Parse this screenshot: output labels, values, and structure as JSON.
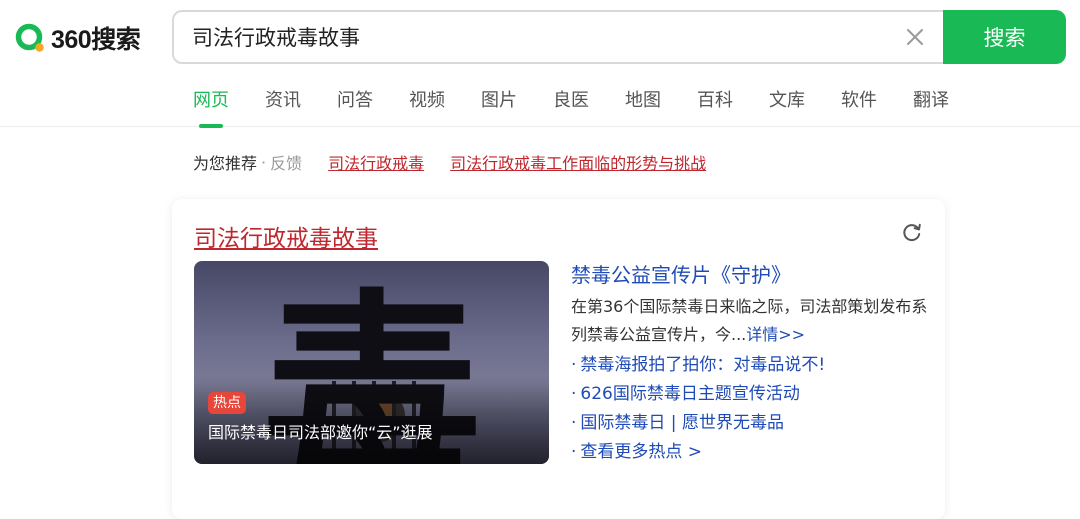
{
  "brand": {
    "logo_text": "360搜索",
    "accent": "#19b955",
    "link_red": "#c0262d",
    "link_blue": "#1f4bb6"
  },
  "search": {
    "query": "司法行政戒毒故事",
    "button_label": "搜索",
    "clear_icon": "close-icon"
  },
  "tabs": [
    {
      "label": "网页",
      "active": true
    },
    {
      "label": "资讯"
    },
    {
      "label": "问答"
    },
    {
      "label": "视频"
    },
    {
      "label": "图片"
    },
    {
      "label": "良医"
    },
    {
      "label": "地图"
    },
    {
      "label": "百科"
    },
    {
      "label": "文库"
    },
    {
      "label": "软件"
    },
    {
      "label": "翻译"
    }
  ],
  "recommend": {
    "label": "为您推荐",
    "separator": "·",
    "feedback": "反馈",
    "links": [
      "司法行政戒毒",
      "司法行政戒毒工作面临的形势与挑战"
    ]
  },
  "result": {
    "title": "司法行政戒毒故事",
    "refresh_icon": "refresh-icon",
    "image": {
      "glyph": "毒",
      "badge": "热点",
      "caption": "国际禁毒日司法部邀你“云”逛展"
    },
    "side": {
      "title": "禁毒公益宣传片《守护》",
      "desc": "在第36个国际禁毒日来临之际，司法部策划发布系列禁毒公益宣传片，今...",
      "detail": "详情>>",
      "items": [
        "禁毒海报拍了拍你：对毒品说不!",
        "626国际禁毒日主题宣传活动",
        "国际禁毒日 | 愿世界无毒品",
        "查看更多热点 >"
      ]
    }
  }
}
